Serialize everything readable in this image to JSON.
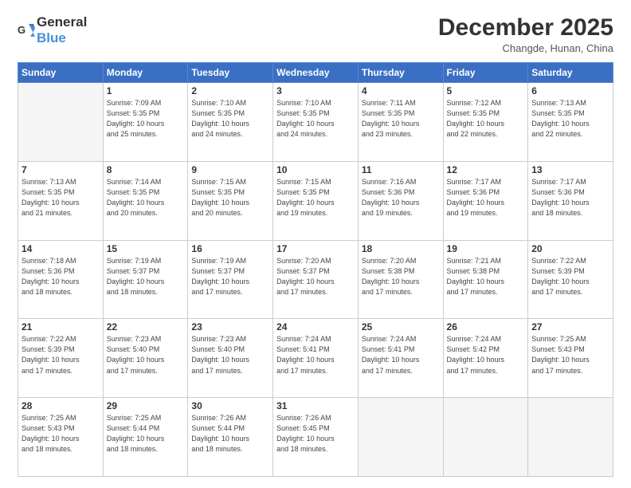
{
  "logo": {
    "general": "General",
    "blue": "Blue"
  },
  "title": "December 2025",
  "location": "Changde, Hunan, China",
  "days_of_week": [
    "Sunday",
    "Monday",
    "Tuesday",
    "Wednesday",
    "Thursday",
    "Friday",
    "Saturday"
  ],
  "weeks": [
    [
      {
        "num": "",
        "info": ""
      },
      {
        "num": "1",
        "info": "Sunrise: 7:09 AM\nSunset: 5:35 PM\nDaylight: 10 hours\nand 25 minutes."
      },
      {
        "num": "2",
        "info": "Sunrise: 7:10 AM\nSunset: 5:35 PM\nDaylight: 10 hours\nand 24 minutes."
      },
      {
        "num": "3",
        "info": "Sunrise: 7:10 AM\nSunset: 5:35 PM\nDaylight: 10 hours\nand 24 minutes."
      },
      {
        "num": "4",
        "info": "Sunrise: 7:11 AM\nSunset: 5:35 PM\nDaylight: 10 hours\nand 23 minutes."
      },
      {
        "num": "5",
        "info": "Sunrise: 7:12 AM\nSunset: 5:35 PM\nDaylight: 10 hours\nand 22 minutes."
      },
      {
        "num": "6",
        "info": "Sunrise: 7:13 AM\nSunset: 5:35 PM\nDaylight: 10 hours\nand 22 minutes."
      }
    ],
    [
      {
        "num": "7",
        "info": "Sunrise: 7:13 AM\nSunset: 5:35 PM\nDaylight: 10 hours\nand 21 minutes."
      },
      {
        "num": "8",
        "info": "Sunrise: 7:14 AM\nSunset: 5:35 PM\nDaylight: 10 hours\nand 20 minutes."
      },
      {
        "num": "9",
        "info": "Sunrise: 7:15 AM\nSunset: 5:35 PM\nDaylight: 10 hours\nand 20 minutes."
      },
      {
        "num": "10",
        "info": "Sunrise: 7:15 AM\nSunset: 5:35 PM\nDaylight: 10 hours\nand 19 minutes."
      },
      {
        "num": "11",
        "info": "Sunrise: 7:16 AM\nSunset: 5:36 PM\nDaylight: 10 hours\nand 19 minutes."
      },
      {
        "num": "12",
        "info": "Sunrise: 7:17 AM\nSunset: 5:36 PM\nDaylight: 10 hours\nand 19 minutes."
      },
      {
        "num": "13",
        "info": "Sunrise: 7:17 AM\nSunset: 5:36 PM\nDaylight: 10 hours\nand 18 minutes."
      }
    ],
    [
      {
        "num": "14",
        "info": "Sunrise: 7:18 AM\nSunset: 5:36 PM\nDaylight: 10 hours\nand 18 minutes."
      },
      {
        "num": "15",
        "info": "Sunrise: 7:19 AM\nSunset: 5:37 PM\nDaylight: 10 hours\nand 18 minutes."
      },
      {
        "num": "16",
        "info": "Sunrise: 7:19 AM\nSunset: 5:37 PM\nDaylight: 10 hours\nand 17 minutes."
      },
      {
        "num": "17",
        "info": "Sunrise: 7:20 AM\nSunset: 5:37 PM\nDaylight: 10 hours\nand 17 minutes."
      },
      {
        "num": "18",
        "info": "Sunrise: 7:20 AM\nSunset: 5:38 PM\nDaylight: 10 hours\nand 17 minutes."
      },
      {
        "num": "19",
        "info": "Sunrise: 7:21 AM\nSunset: 5:38 PM\nDaylight: 10 hours\nand 17 minutes."
      },
      {
        "num": "20",
        "info": "Sunrise: 7:22 AM\nSunset: 5:39 PM\nDaylight: 10 hours\nand 17 minutes."
      }
    ],
    [
      {
        "num": "21",
        "info": "Sunrise: 7:22 AM\nSunset: 5:39 PM\nDaylight: 10 hours\nand 17 minutes."
      },
      {
        "num": "22",
        "info": "Sunrise: 7:23 AM\nSunset: 5:40 PM\nDaylight: 10 hours\nand 17 minutes."
      },
      {
        "num": "23",
        "info": "Sunrise: 7:23 AM\nSunset: 5:40 PM\nDaylight: 10 hours\nand 17 minutes."
      },
      {
        "num": "24",
        "info": "Sunrise: 7:24 AM\nSunset: 5:41 PM\nDaylight: 10 hours\nand 17 minutes."
      },
      {
        "num": "25",
        "info": "Sunrise: 7:24 AM\nSunset: 5:41 PM\nDaylight: 10 hours\nand 17 minutes."
      },
      {
        "num": "26",
        "info": "Sunrise: 7:24 AM\nSunset: 5:42 PM\nDaylight: 10 hours\nand 17 minutes."
      },
      {
        "num": "27",
        "info": "Sunrise: 7:25 AM\nSunset: 5:43 PM\nDaylight: 10 hours\nand 17 minutes."
      }
    ],
    [
      {
        "num": "28",
        "info": "Sunrise: 7:25 AM\nSunset: 5:43 PM\nDaylight: 10 hours\nand 18 minutes."
      },
      {
        "num": "29",
        "info": "Sunrise: 7:25 AM\nSunset: 5:44 PM\nDaylight: 10 hours\nand 18 minutes."
      },
      {
        "num": "30",
        "info": "Sunrise: 7:26 AM\nSunset: 5:44 PM\nDaylight: 10 hours\nand 18 minutes."
      },
      {
        "num": "31",
        "info": "Sunrise: 7:26 AM\nSunset: 5:45 PM\nDaylight: 10 hours\nand 18 minutes."
      },
      {
        "num": "",
        "info": ""
      },
      {
        "num": "",
        "info": ""
      },
      {
        "num": "",
        "info": ""
      }
    ]
  ]
}
